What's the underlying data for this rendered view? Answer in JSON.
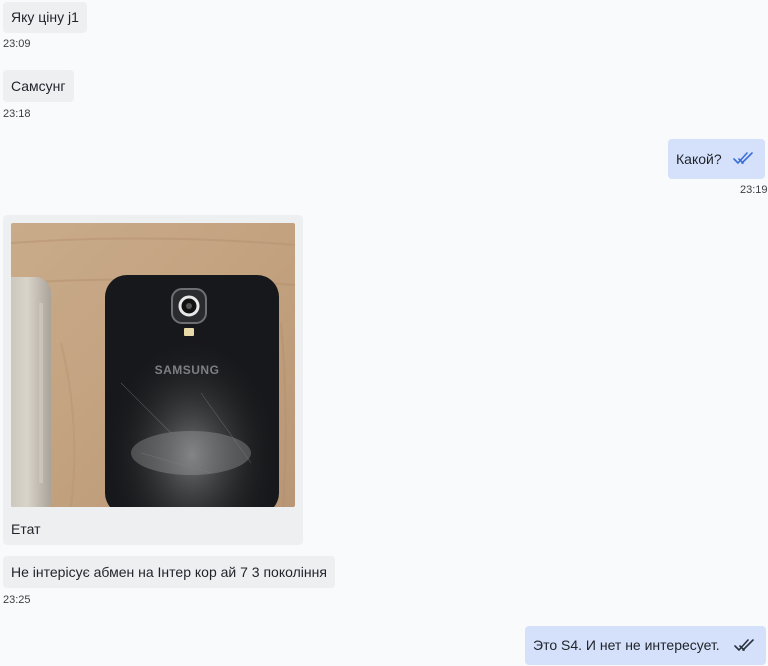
{
  "messages": [
    {
      "dir": "in",
      "text": "Яку ціну j1",
      "time": "23:09"
    },
    {
      "dir": "in",
      "text": "Самсунг",
      "time": "23:18"
    },
    {
      "dir": "out",
      "text": "Какой?",
      "time": "23:19",
      "status_icon": "double-check-icon"
    },
    {
      "dir": "in",
      "type": "photo",
      "image_desc": "photo-of-two-phones",
      "caption": "Етат"
    },
    {
      "dir": "in",
      "text": "Не інтерісує абмен на Інтер кор ай 7 3 покоління",
      "time": "23:25"
    },
    {
      "dir": "out",
      "text": "Это S4. И нет не интересует.",
      "status_icon": "double-check-icon"
    }
  ],
  "colors": {
    "background": "#f9fafb",
    "incoming_bubble": "#eeeff1",
    "outgoing_bubble": "#d5e1fb",
    "read_check": "#3a6fd8",
    "check_dark": "#2b3340"
  }
}
